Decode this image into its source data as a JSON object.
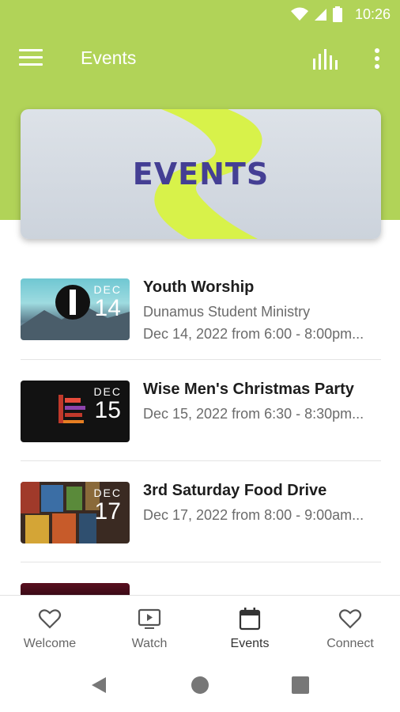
{
  "status_bar": {
    "time": "10:26",
    "icons": [
      "wifi-icon",
      "signal-icon",
      "battery-icon"
    ]
  },
  "app_bar": {
    "title": "Events",
    "menu_icon": "hamburger-menu-icon",
    "chart_icon": "bars-icon",
    "more_icon": "more-vertical-icon"
  },
  "colors": {
    "accent": "#b1d358",
    "banner_text": "#443f94",
    "banner_swoosh": "#d8f24a"
  },
  "banner": {
    "text": "EVENTS"
  },
  "events": [
    {
      "title": "Youth Worship",
      "subtitle": "Dunamus Student Ministry",
      "details": "Dec 14, 2022 from 6:00 - 8:00pm...",
      "month": "DEC",
      "day": "14"
    },
    {
      "title": "Wise Men's Christmas Party",
      "details": "Dec 15, 2022 from 6:30 - 8:30pm...",
      "month": "DEC",
      "day": "15"
    },
    {
      "title": "3rd Saturday Food Drive",
      "details": "Dec 17, 2022 from 8:00 - 9:00am...",
      "month": "DEC",
      "day": "17"
    }
  ],
  "bottom_nav": [
    {
      "label": "Welcome",
      "icon": "heart-icon"
    },
    {
      "label": "Watch",
      "icon": "tv-play-icon"
    },
    {
      "label": "Events",
      "icon": "calendar-icon",
      "active": true
    },
    {
      "label": "Connect",
      "icon": "heart-icon"
    }
  ],
  "system_nav": [
    "back-icon",
    "home-icon",
    "recents-icon"
  ]
}
